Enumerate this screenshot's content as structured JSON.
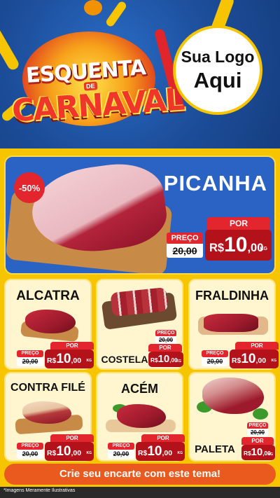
{
  "header": {
    "title_line1": "ESQUENTA",
    "title_de": "DE",
    "title_line2": "CARNAVAL",
    "logo_line1": "Sua Logo",
    "logo_line2": "Aqui"
  },
  "hero": {
    "badge": "-50%",
    "name": "PICANHA",
    "price": {
      "preco_label": "PREÇO",
      "old": "20,00",
      "por_label": "POR",
      "currency": "R$",
      "new_int": "10",
      "new_cents": ",00",
      "unit": "KG"
    }
  },
  "products": [
    {
      "name": "ALCATRA",
      "price": {
        "preco_label": "PREÇO",
        "old": "20,00",
        "por_label": "POR",
        "currency": "R$",
        "new_int": "10",
        "new_cents": ",00",
        "unit": "KG"
      }
    },
    {
      "name": "COSTELA",
      "price": {
        "preco_label": "PREÇO",
        "old": "20,00",
        "por_label": "POR",
        "currency": "R$",
        "new_int": "10",
        "new_cents": ",00",
        "unit": "KG"
      }
    },
    {
      "name": "FRALDINHA",
      "price": {
        "preco_label": "PREÇO",
        "old": "20,00",
        "por_label": "POR",
        "currency": "R$",
        "new_int": "10",
        "new_cents": ",00",
        "unit": "KG"
      }
    },
    {
      "name": "CONTRA FILÉ",
      "price": {
        "preco_label": "PREÇO",
        "old": "20,00",
        "por_label": "POR",
        "currency": "R$",
        "new_int": "10",
        "new_cents": ",00",
        "unit": "KG"
      }
    },
    {
      "name": "ACÉM",
      "price": {
        "preco_label": "PREÇO",
        "old": "20,00",
        "por_label": "POR",
        "currency": "R$",
        "new_int": "10",
        "new_cents": ",00",
        "unit": "KG"
      }
    },
    {
      "name": "PALETA",
      "price": {
        "preco_label": "PREÇO",
        "old": "20,00",
        "por_label": "POR",
        "currency": "R$",
        "new_int": "10",
        "new_cents": ",00",
        "unit": "KG"
      }
    }
  ],
  "cta_label": "Crie seu encarte com este tema!",
  "disclaimer": "*Imagens Meramente Ilustrativas",
  "colors": {
    "board_yellow": "#f7c400",
    "hero_blue": "#2b63c4",
    "price_red": "#e3252d",
    "cta_orange": "#ea5a1e"
  }
}
